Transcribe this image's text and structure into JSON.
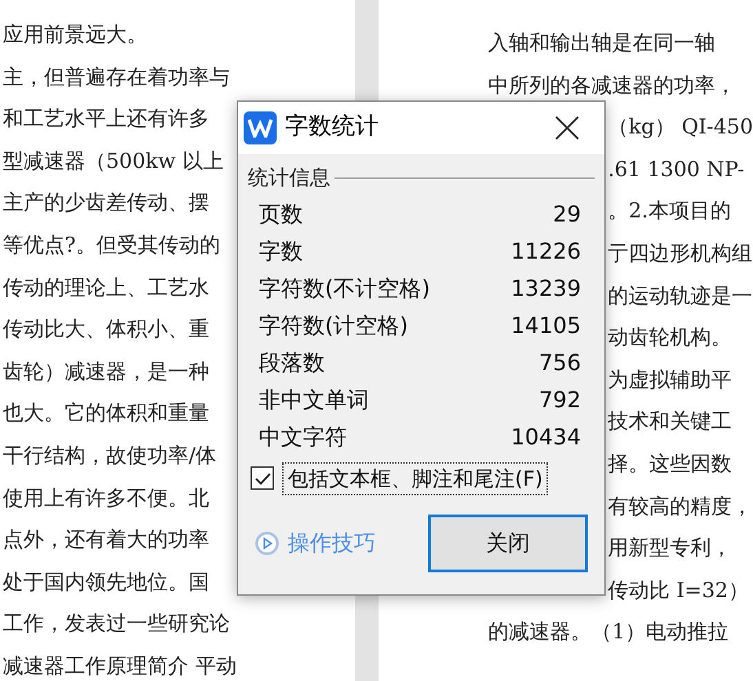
{
  "left_page": {
    "lines": [
      {
        "text": "应用前景远大。"
      },
      {
        "text": "主，但普遍存在着功率与"
      },
      {
        "text": "和工艺水平上还有许多"
      },
      {
        "text": "型减速器（500kw 以上"
      },
      {
        "text": "主产的少齿差传动、摆"
      },
      {
        "text": "等优点?。但受其传动的"
      },
      {
        "text": "传动的理论上、工艺水"
      },
      {
        "text": "传动比大、体积小、重"
      },
      {
        "text": "齿轮）减速器，是一种"
      },
      {
        "text": "也大。它的体积和重量"
      },
      {
        "text": "干行结构，故使功率/体"
      },
      {
        "text": "使用上有许多不便。北"
      },
      {
        "text": "点外，还有着大的功率"
      },
      {
        "text": "处于国内领先地位。国"
      },
      {
        "text": "工作，发表过一些研究论"
      },
      {
        "text": "减速器工作原理简介 平动"
      }
    ]
  },
  "right_page": {
    "lines": [
      {
        "text": "入轴和输出轴是在同一轴",
        "kind": "line"
      },
      {
        "text": "中所列的各减速器的功率，",
        "kind": "line"
      },
      {
        "text": "（kg） QI-450",
        "kind": "tail"
      },
      {
        "text": ".61 1300 NP-",
        "kind": "tail"
      },
      {
        "text": "。2.本项目的",
        "kind": "tail"
      },
      {
        "text": "亍四边形机构组",
        "kind": "tail"
      },
      {
        "text": "的运动轨迹是一",
        "kind": "tail"
      },
      {
        "text": "动齿轮机构。",
        "kind": "tail"
      },
      {
        "text": "为虚拟辅助平",
        "kind": "tail"
      },
      {
        "text": "技术和关键工",
        "kind": "tail"
      },
      {
        "text": "择。这些因数",
        "kind": "tail"
      },
      {
        "text": "有较高的精度，",
        "kind": "tail"
      },
      {
        "text": "用新型专利，",
        "kind": "tail"
      },
      {
        "text": "传动比 I=32）",
        "kind": "tail"
      },
      {
        "text": "的减速器。（1）电动推拉",
        "kind": "line"
      }
    ]
  },
  "dialog": {
    "title": "字数统计",
    "group_label": "统计信息",
    "stats": [
      {
        "label": "页数",
        "value": "29"
      },
      {
        "label": "字数",
        "value": "11226"
      },
      {
        "label": "字符数(不计空格)",
        "value": "13239"
      },
      {
        "label": "字符数(计空格)",
        "value": "14105"
      },
      {
        "label": "段落数",
        "value": "756"
      },
      {
        "label": "非中文单词",
        "value": "792"
      },
      {
        "label": "中文字符",
        "value": "10434"
      }
    ],
    "include_checkbox": {
      "label": "包括文本框、脚注和尾注(F)",
      "checked": true
    },
    "tips_link": "操作技巧",
    "close_button": "关闭"
  }
}
